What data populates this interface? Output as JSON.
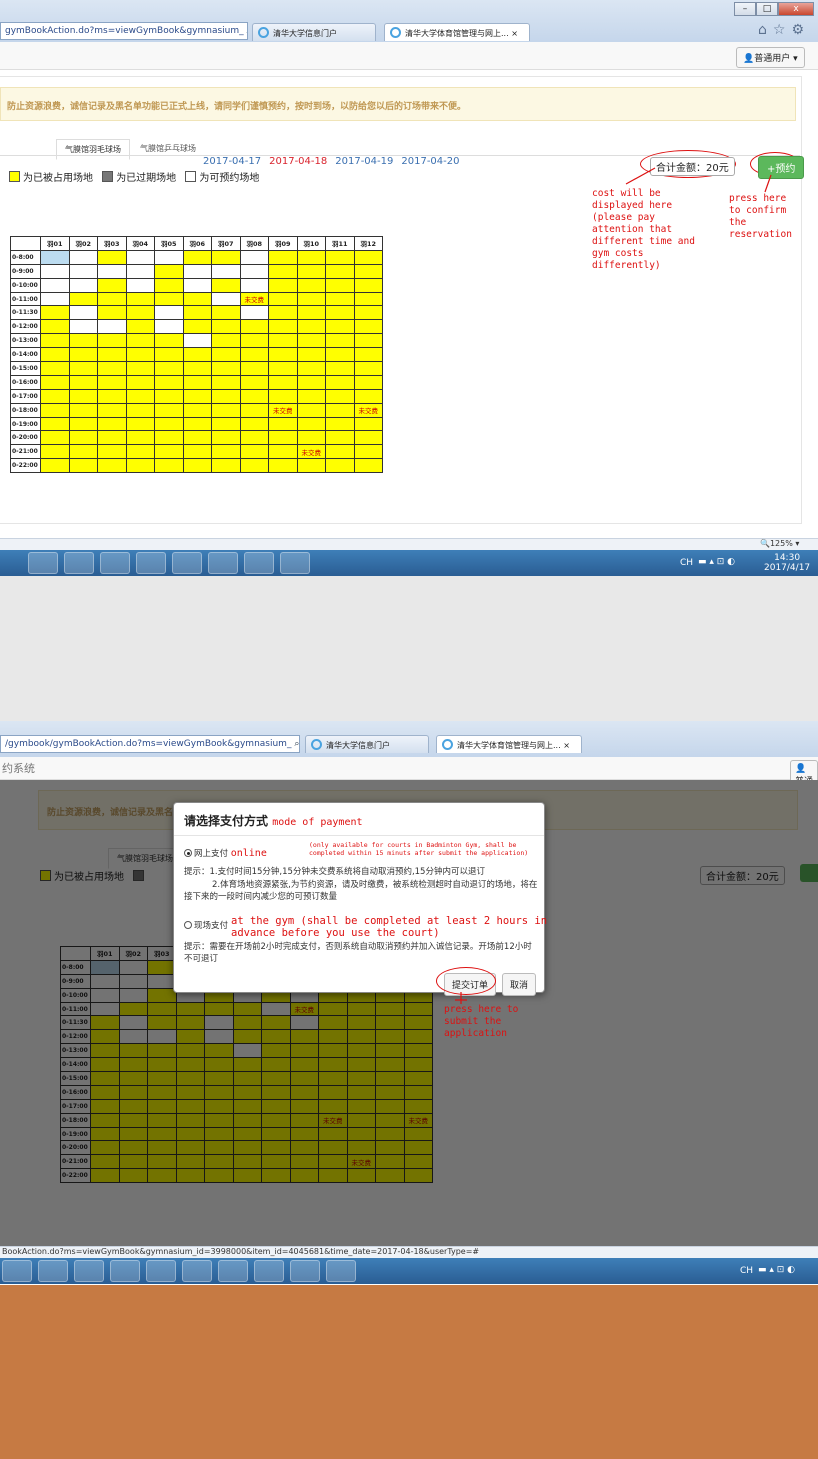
{
  "top": {
    "address": "gymBookAction.do?ms=viewGymBook&gymnasium_",
    "tabs": [
      "清华大学信息门户",
      "清华大学体育馆管理与网上..."
    ],
    "tab_close": "×",
    "user_button": "普通用户",
    "notice": "防止资源浪费，诚信记录及黑名单功能已正式上线，请同学们谨慎预约，按时到场，以防给您以后的订场带来不便。",
    "gym_tabs": [
      "气膜馆羽毛球场",
      "气膜馆乒乓球场"
    ],
    "dates": [
      "2017-04-17",
      "2017-04-18",
      "2017-04-19",
      "2017-04-20"
    ],
    "legend": [
      "为已被占用场地",
      "为已过期场地",
      "为可预约场地"
    ],
    "total": "合计金额：20元",
    "reserve_button": "+预约",
    "annotation_cost": "cost will be\ndisplayed here\n(please pay\nattention that\ndifferent time and\ngym costs\ndifferently)",
    "annotation_press": "press here\nto confirm\nthe\nreservation",
    "zoom": "125%",
    "clock_time": "14:30",
    "clock_date": "2017/4/17",
    "ime": "CH"
  },
  "grid": {
    "courts": [
      "羽01",
      "羽02",
      "羽03",
      "羽04",
      "羽05",
      "羽06",
      "羽07",
      "羽08",
      "羽09",
      "羽10",
      "羽11",
      "羽12"
    ],
    "times": [
      "0-8:00",
      "0-9:00",
      "0-10:00",
      "0-11:00",
      "0-11:30",
      "0-12:00",
      "0-13:00",
      "0-14:00",
      "0-15:00",
      "0-16:00",
      "0-17:00",
      "0-18:00",
      "0-19:00",
      "0-20:00",
      "0-21:00",
      "0-22:00"
    ],
    "unpaid_label": "未交费"
  },
  "bottom": {
    "address": "/gymbook/gymBookAction.do?ms=viewGymBook&gymnasium_",
    "site_title": "约系统",
    "user_button": "普通",
    "status_url": "BookAction.do?ms=viewGymBook&gymnasium_id=3998000&item_id=4045681&time_date=2017-04-18&userType=#",
    "dialog": {
      "title": "请选择支付方式",
      "title_annotation": "mode of payment",
      "option_online": "网上支付",
      "online_annotation_word": "online",
      "online_note": "(only available for courts in Badminton Gym, shall be\ncompleted within 15 minuts after submit the application)",
      "tip_online_1": "提示：1.支付时间15分钟,15分钟未交费系统将自动取消预约,15分钟内可以退订",
      "tip_online_2": "2.体育场地资源紧张,为节约资源，请及时缴费，被系统检测超时自动退订的场地，将在接下来的一段时间内减少您的可预订数量",
      "option_gym": "现场支付",
      "gym_annotation": "at the gym (shall be completed at least 2 hours in\nadvance before you use the court)",
      "tip_gym": "提示：需要在开场前2小时完成支付，否则系统自动取消预约并加入诚信记录。开场前12小时不可退订",
      "submit_button": "提交订单",
      "cancel_button": "取消",
      "submit_annotation": "press here to\nsubmit the\napplication"
    }
  }
}
